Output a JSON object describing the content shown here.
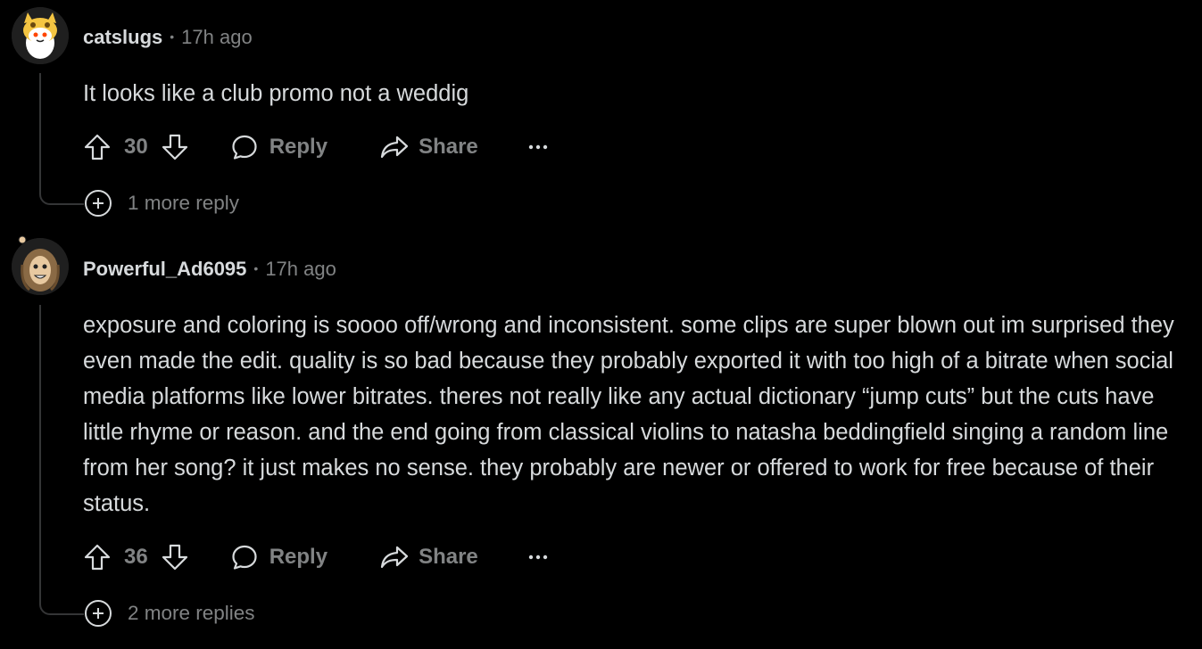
{
  "comments": [
    {
      "author": "catslugs",
      "time": "17h ago",
      "text": "It looks like a club promo not a weddig",
      "score": "30",
      "reply_label": "Reply",
      "share_label": "Share",
      "more_replies": "1 more reply"
    },
    {
      "author": "Powerful_Ad6095",
      "time": "17h ago",
      "text": "exposure and coloring is soooo off/wrong and inconsistent. some clips are super blown out im surprised they even made the edit. quality is so bad because they probably exported it with too high of a bitrate when social media platforms like lower bitrates. theres not really like any actual dictionary “jump cuts” but the cuts have little rhyme or reason. and the end going from classical violins to natasha beddingfield singing a random line from her song? it just makes no sense. they probably are newer or offered to work for free because of their status.",
      "score": "36",
      "reply_label": "Reply",
      "share_label": "Share",
      "more_replies": "2 more replies"
    }
  ]
}
